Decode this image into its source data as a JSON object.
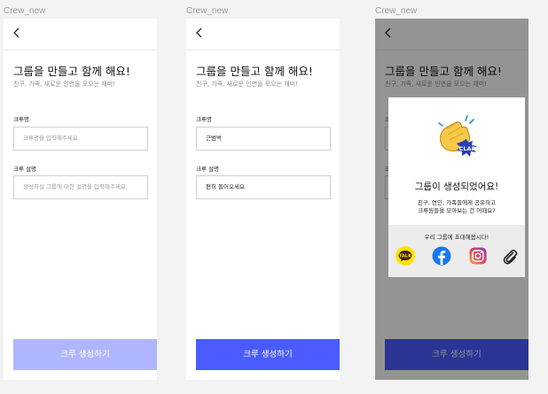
{
  "frames": [
    {
      "label": "Crew_new",
      "title": "그룹을 만들고 함께 해요!",
      "subtitle": "친구, 가족, 새로운 인연을 모으는 재미!",
      "name_label": "크루명",
      "name_value": "크루명을 입력해주세요.",
      "desc_label": "크루 설명",
      "desc_value": "생성하실 그룹에 대한 설명을 입력해주세요.",
      "button": "크루 생성하기"
    },
    {
      "label": "Crew_new",
      "title": "그룹을 만들고 함께 해요!",
      "subtitle": "친구, 가족, 새로운 인연을 모으는 재미!",
      "name_label": "크루명",
      "name_value": "근범벅",
      "desc_label": "크루 설명",
      "desc_value": "편히 들어오세요",
      "button": "크루 생성하기"
    },
    {
      "label": "Crew_new",
      "title": "그룹을 만들고 함께 해요!",
      "subtitle": "친구, 가족, 새로운 인연을 모으는 재미!",
      "button": "크루 생성하기"
    }
  ],
  "modal": {
    "sticker_text": "CLAP",
    "title": "그룹이 생성되었어요!",
    "desc_line1": "친구, 연인, 가족들에게 공유하고",
    "desc_line2": "크루원들을 모아보는 건 어때요?",
    "share_title": "우리 그룹에 초대해봅시다!",
    "kakao_label": "TALK",
    "icons": [
      "kakaotalk-icon",
      "facebook-icon",
      "instagram-icon",
      "link-icon"
    ]
  },
  "colors": {
    "primary": "#4a5bff",
    "primary_disabled": "#afb6ff",
    "kakao": "#fee500",
    "facebook": "#1877f2"
  }
}
